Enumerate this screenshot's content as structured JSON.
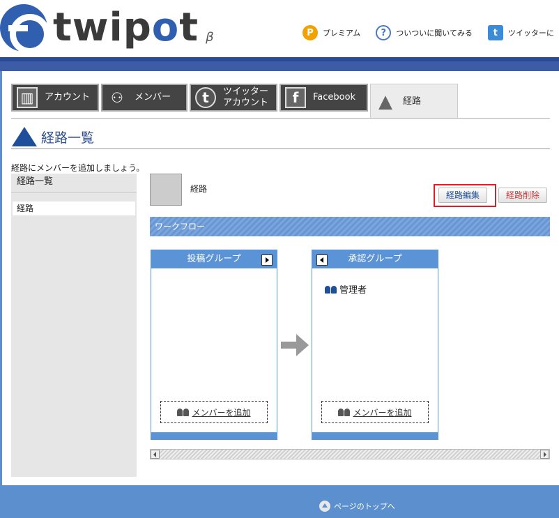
{
  "brand": {
    "logo_text_a": "twip",
    "logo_text_o": "o",
    "logo_text_b": "t",
    "beta": "β"
  },
  "top_links": [
    {
      "icon": "premium-icon",
      "label": "プレミアム"
    },
    {
      "icon": "question-icon",
      "label": "ついついに聞いてみる"
    },
    {
      "icon": "twitter-icon",
      "label": "ツイッターに"
    }
  ],
  "tabs": [
    {
      "icon": "building-icon",
      "label": "アカウント",
      "active": false
    },
    {
      "icon": "people-icon",
      "label": "メンバー",
      "active": false
    },
    {
      "icon": "twitter-t-icon",
      "label": "ツイッター\nアカウント",
      "active": false
    },
    {
      "icon": "facebook-icon",
      "label": "Facebook",
      "active": false
    },
    {
      "icon": "road-icon",
      "label": "経路",
      "active": true
    }
  ],
  "page_title": "経路一覧",
  "intro": "経路にメンバーを追加しましょう。",
  "sidebar": {
    "header": "経路一覧",
    "items": [
      "経路"
    ]
  },
  "route": {
    "name": "経路",
    "edit_button": "経路編集",
    "delete_button": "経路削除"
  },
  "workflow": {
    "label": "ワークフロー",
    "groups": [
      {
        "title": "投稿グループ",
        "members": [],
        "add_label": "メンバーを追加"
      },
      {
        "title": "承認グループ",
        "members": [
          "管理者"
        ],
        "add_label": "メンバーを追加"
      }
    ]
  },
  "footer": {
    "back_to_top": "ページのトップへ"
  },
  "colors": {
    "brand_blue": "#2f5fae",
    "accent_blue": "#5b94d6",
    "highlight_red": "#d9202a",
    "delete_red": "#cc3a3a"
  }
}
